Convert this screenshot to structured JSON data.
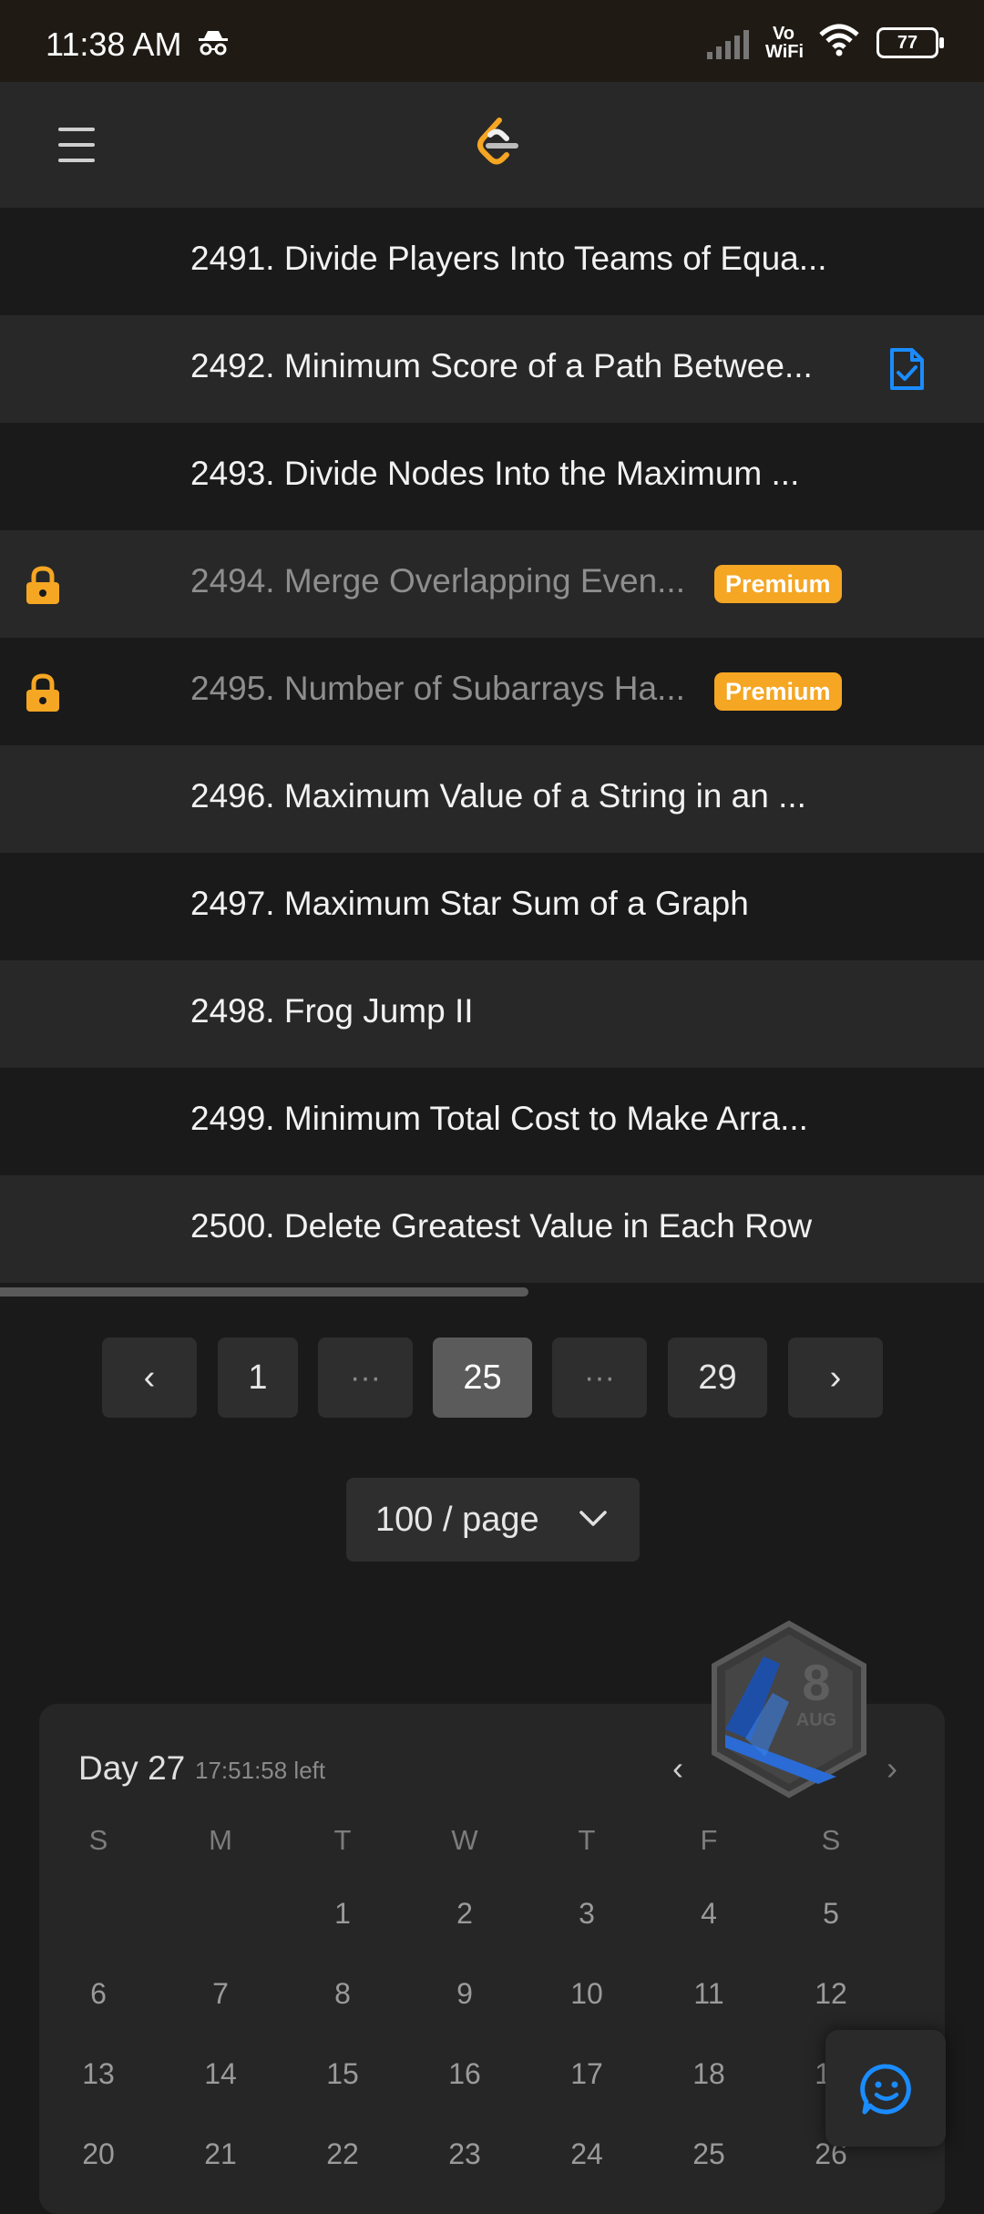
{
  "status_bar": {
    "time": "11:38 AM",
    "network": "Vo WiFi",
    "battery": "77"
  },
  "nav": {
    "menu_icon": "hamburger-menu-icon",
    "logo_icon": "leetcode-logo-icon"
  },
  "problems": [
    {
      "title": "2491. Divide Players Into Teams of Equa...",
      "locked": false,
      "premium": false,
      "solved": false
    },
    {
      "title": "2492. Minimum Score of a Path Betwee...",
      "locked": false,
      "premium": false,
      "solved": true
    },
    {
      "title": "2493. Divide Nodes Into the Maximum ...",
      "locked": false,
      "premium": false,
      "solved": false
    },
    {
      "title": "2494. Merge Overlapping Even...",
      "locked": true,
      "premium": true,
      "premium_label": "Premium",
      "solved": false
    },
    {
      "title": "2495. Number of Subarrays Ha...",
      "locked": true,
      "premium": true,
      "premium_label": "Premium",
      "solved": false
    },
    {
      "title": "2496. Maximum Value of a String in an ...",
      "locked": false,
      "premium": false,
      "solved": false
    },
    {
      "title": "2497. Maximum Star Sum of a Graph",
      "locked": false,
      "premium": false,
      "solved": false
    },
    {
      "title": "2498. Frog Jump II",
      "locked": false,
      "premium": false,
      "solved": false
    },
    {
      "title": "2499. Minimum Total Cost to Make Arra...",
      "locked": false,
      "premium": false,
      "solved": false
    },
    {
      "title": "2500. Delete Greatest Value in Each Row",
      "locked": false,
      "premium": false,
      "solved": false
    }
  ],
  "pagination": {
    "prev": "‹",
    "first": "1",
    "ellipsis": "···",
    "current": "25",
    "last": "29",
    "next": "›"
  },
  "per_page": {
    "label": "100 / page"
  },
  "calendar": {
    "day_label": "Day 27",
    "time_left": "17:51:58 left",
    "prev": "‹",
    "next": "›",
    "weekdays": [
      "S",
      "M",
      "T",
      "W",
      "T",
      "F",
      "S"
    ],
    "weeks": [
      [
        "",
        "",
        "1",
        "2",
        "3",
        "4",
        "5"
      ],
      [
        "6",
        "7",
        "8",
        "9",
        "10",
        "11",
        "12"
      ],
      [
        "13",
        "14",
        "15",
        "16",
        "17",
        "18",
        "19"
      ],
      [
        "20",
        "21",
        "22",
        "23",
        "24",
        "25",
        "26"
      ]
    ],
    "badge": {
      "number": "8",
      "month": "AUG"
    }
  },
  "colors": {
    "premium": "#f5a623",
    "solved": "#1a8cff",
    "lock": "#f5a623"
  }
}
